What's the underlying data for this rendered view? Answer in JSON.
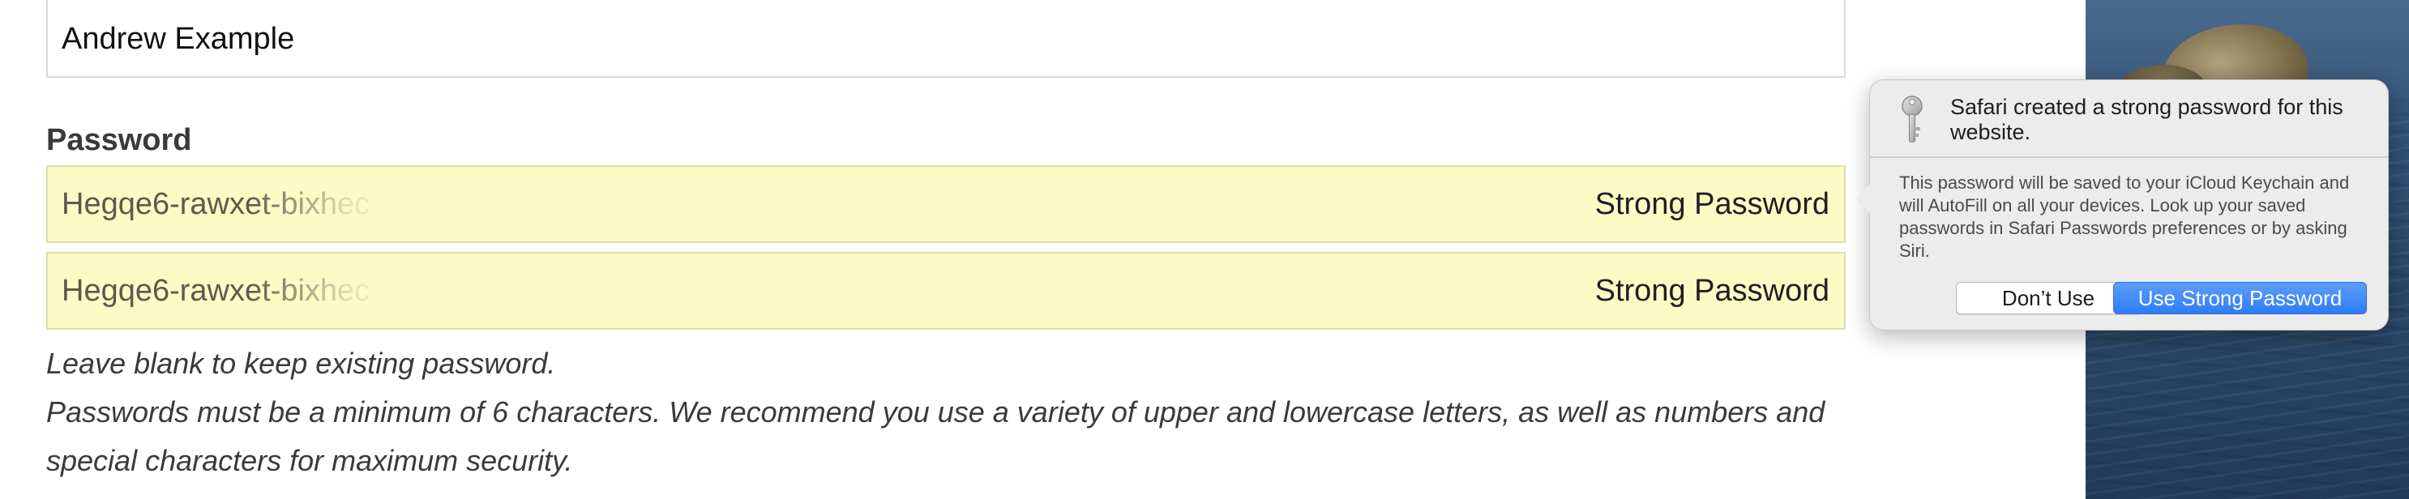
{
  "form": {
    "name_value": "Andrew Example",
    "password_label": "Password",
    "password_field": {
      "value": "Hegqe6-rawxet-bixhec",
      "strength_label": "Strong Password"
    },
    "confirm_field": {
      "value": "Hegqe6-rawxet-bixhec",
      "strength_label": "Strong Password"
    },
    "hints": {
      "line1": "Leave blank to keep existing password.",
      "line2": "Passwords must be a minimum of 6 characters. We recommend you use a variety of upper and lowercase letters, as well as numbers and",
      "line3": "special characters for maximum security."
    }
  },
  "popover": {
    "icon": "key-icon",
    "title": "Safari created a strong password for this website.",
    "body": "This password will be saved to your iCloud Keychain and will AutoFill on all your devices. Look up your saved passwords in Safari Passwords preferences or by asking Siri.",
    "dont_use_label": "Don’t Use",
    "use_strong_label": "Use Strong Password"
  },
  "colors": {
    "autofill_yellow": "#fafbc5",
    "primary_blue": "#2f7cf6"
  }
}
